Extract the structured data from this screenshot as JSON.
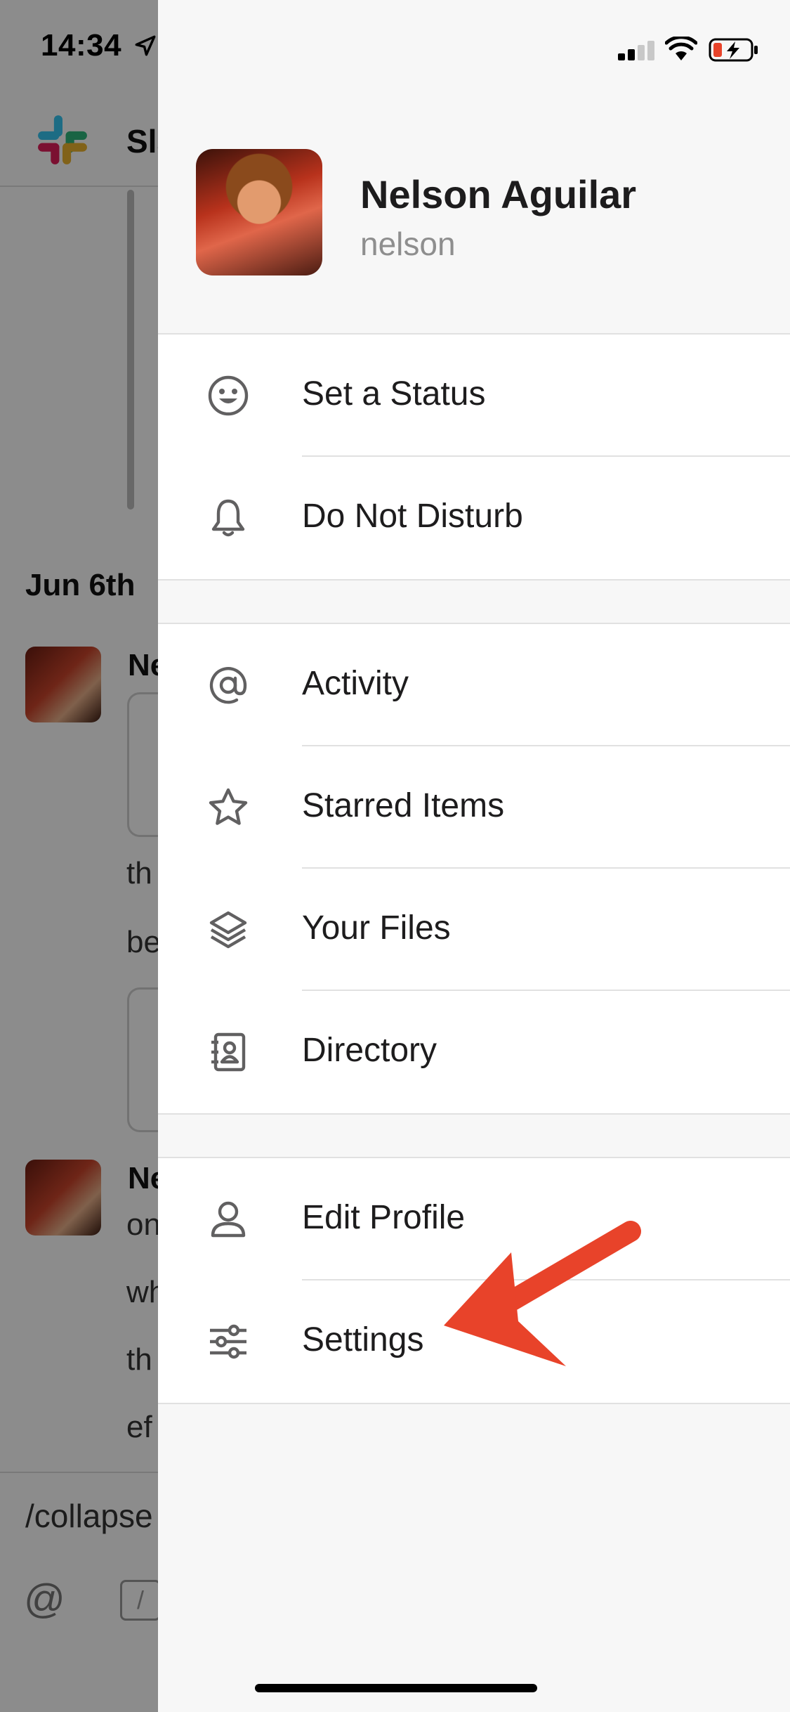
{
  "status_bar": {
    "time": "14:34"
  },
  "background": {
    "app_title": "Sla",
    "date_divider": "Jun 6th",
    "messages": [
      {
        "author_fragment": "Ne",
        "lines": [
          "th",
          "be"
        ]
      },
      {
        "author_fragment": "Ne",
        "lines": [
          "on",
          "wh",
          "th",
          "ef"
        ]
      }
    ],
    "composer": {
      "value": "/collapse"
    },
    "composer_tools": {
      "mention": "@",
      "slash": "/"
    }
  },
  "profile": {
    "name": "Nelson Aguilar",
    "handle": "nelson"
  },
  "menu": {
    "section1": [
      {
        "label": "Set a Status",
        "icon": "smile-icon"
      },
      {
        "label": "Do Not Disturb",
        "icon": "bell-icon"
      }
    ],
    "section2": [
      {
        "label": "Activity",
        "icon": "at-sign-icon"
      },
      {
        "label": "Starred Items",
        "icon": "star-icon"
      },
      {
        "label": "Your Files",
        "icon": "layers-icon"
      },
      {
        "label": "Directory",
        "icon": "directory-icon"
      }
    ],
    "section3": [
      {
        "label": "Edit Profile",
        "icon": "person-icon"
      },
      {
        "label": "Settings",
        "icon": "sliders-icon"
      }
    ]
  },
  "colors": {
    "annotation_arrow": "#e8432a",
    "battery_low": "#e8432a",
    "icon_gray": "#616061"
  }
}
